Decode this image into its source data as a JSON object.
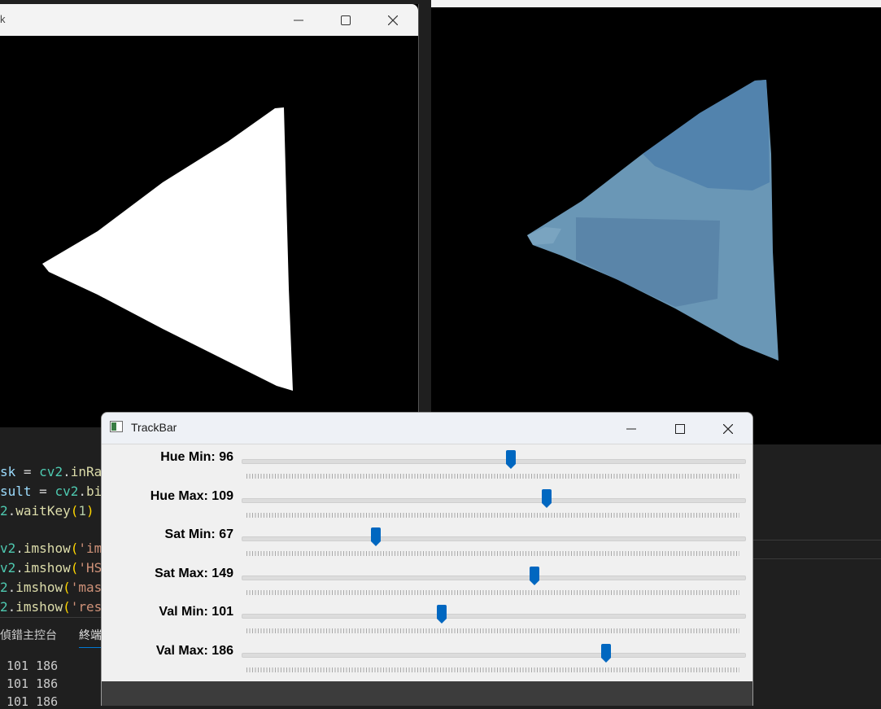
{
  "editor": {
    "code_lines": [
      [
        {
          "t": "sk",
          "c": "tok-var"
        },
        {
          "t": " = ",
          "c": "tok-plain"
        },
        {
          "t": "cv2",
          "c": "tok-mod"
        },
        {
          "t": ".",
          "c": "tok-plain"
        },
        {
          "t": "inRa",
          "c": "tok-fn"
        }
      ],
      [
        {
          "t": "sult",
          "c": "tok-var"
        },
        {
          "t": " = ",
          "c": "tok-plain"
        },
        {
          "t": "cv2",
          "c": "tok-mod"
        },
        {
          "t": ".",
          "c": "tok-plain"
        },
        {
          "t": "bi",
          "c": "tok-fn"
        }
      ],
      [
        {
          "t": "2",
          "c": "tok-mod"
        },
        {
          "t": ".",
          "c": "tok-plain"
        },
        {
          "t": "waitKey",
          "c": "tok-fn"
        },
        {
          "t": "(",
          "c": "tok-pun"
        },
        {
          "t": "1",
          "c": "tok-num"
        },
        {
          "t": ")",
          "c": "tok-pun"
        }
      ],
      [
        {
          "t": "v2",
          "c": "tok-mod"
        },
        {
          "t": ".",
          "c": "tok-plain"
        },
        {
          "t": "imshow",
          "c": "tok-fn"
        },
        {
          "t": "(",
          "c": "tok-pun"
        },
        {
          "t": "'im",
          "c": "tok-str"
        }
      ],
      [
        {
          "t": "v2",
          "c": "tok-mod"
        },
        {
          "t": ".",
          "c": "tok-plain"
        },
        {
          "t": "imshow",
          "c": "tok-fn"
        },
        {
          "t": "(",
          "c": "tok-pun"
        },
        {
          "t": "'HS",
          "c": "tok-str"
        }
      ],
      [
        {
          "t": "2",
          "c": "tok-mod"
        },
        {
          "t": ".",
          "c": "tok-plain"
        },
        {
          "t": "imshow",
          "c": "tok-fn"
        },
        {
          "t": "(",
          "c": "tok-pun"
        },
        {
          "t": "'mas",
          "c": "tok-str"
        }
      ],
      [
        {
          "t": "2",
          "c": "tok-mod"
        },
        {
          "t": ".",
          "c": "tok-plain"
        },
        {
          "t": "imshow",
          "c": "tok-fn"
        },
        {
          "t": "(",
          "c": "tok-pun"
        },
        {
          "t": "'res",
          "c": "tok-str"
        }
      ]
    ],
    "panel_tabs": [
      "偵錯主控台",
      "終端"
    ],
    "terminal_lines": [
      "101 186",
      "101 186",
      "101 186"
    ]
  },
  "mask_window": {
    "title_fragment": "k",
    "icons": [
      "minimize-icon",
      "maximize-icon",
      "close-icon"
    ]
  },
  "trackbar_window": {
    "title": "TrackBar",
    "icons": [
      "app-icon",
      "minimize-icon",
      "maximize-icon",
      "close-icon"
    ],
    "sliders": [
      {
        "label": "Hue Min: 96",
        "value": 96,
        "max": 179
      },
      {
        "label": "Hue Max: 109",
        "value": 109,
        "max": 179
      },
      {
        "label": "Sat Min: 67",
        "value": 67,
        "max": 255
      },
      {
        "label": "Sat Max: 149",
        "value": 149,
        "max": 255
      },
      {
        "label": "Val Min: 101",
        "value": 101,
        "max": 255
      },
      {
        "label": "Val Max: 186",
        "value": 186,
        "max": 255
      }
    ],
    "thumb_color": "#0067c0"
  },
  "colors": {
    "editor_bg": "#1f1f1f",
    "mask_fill": "#ffffff",
    "result_fill_light": "#6a97b6",
    "result_fill_dark": "#4f7fa8"
  }
}
